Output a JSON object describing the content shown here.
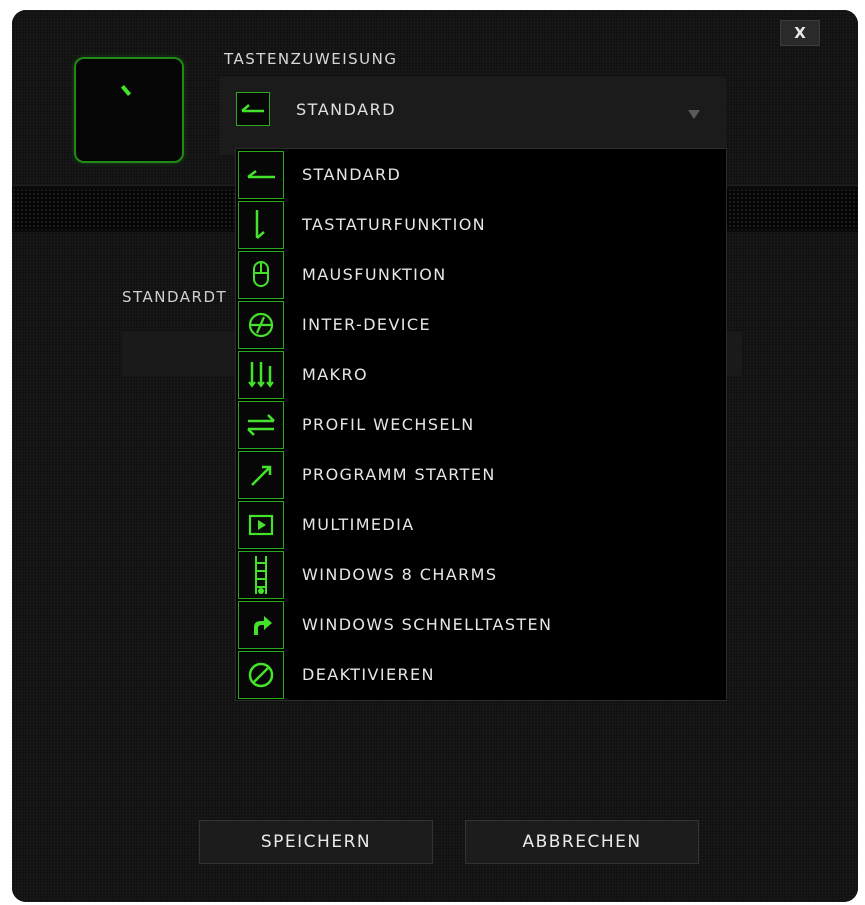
{
  "dialog": {
    "close_label": "X",
    "section_label": "TASTENZUWEISUNG",
    "selected_value": "STANDARD",
    "underlying_label": "STANDARDT"
  },
  "menu": {
    "items": [
      {
        "label": "STANDARD",
        "icon": "arrow-left-icon"
      },
      {
        "label": "TASTATURFUNKTION",
        "icon": "keyboard-arrow-icon"
      },
      {
        "label": "MAUSFUNKTION",
        "icon": "mouse-icon"
      },
      {
        "label": "INTER-DEVICE",
        "icon": "inter-device-icon"
      },
      {
        "label": "MAKRO",
        "icon": "macro-icon"
      },
      {
        "label": "PROFIL WECHSELN",
        "icon": "switch-profile-icon"
      },
      {
        "label": "PROGRAMM STARTEN",
        "icon": "launch-program-icon"
      },
      {
        "label": "MULTIMEDIA",
        "icon": "multimedia-icon"
      },
      {
        "label": "WINDOWS 8 CHARMS",
        "icon": "charms-icon"
      },
      {
        "label": "WINDOWS SCHNELLTASTEN",
        "icon": "shortcut-icon"
      },
      {
        "label": "DEAKTIVIEREN",
        "icon": "disable-icon"
      }
    ]
  },
  "footer": {
    "save_label": "SPEICHERN",
    "cancel_label": "ABBRECHEN"
  },
  "colors": {
    "accent": "#44e22a",
    "background": "#0b0b0b"
  }
}
